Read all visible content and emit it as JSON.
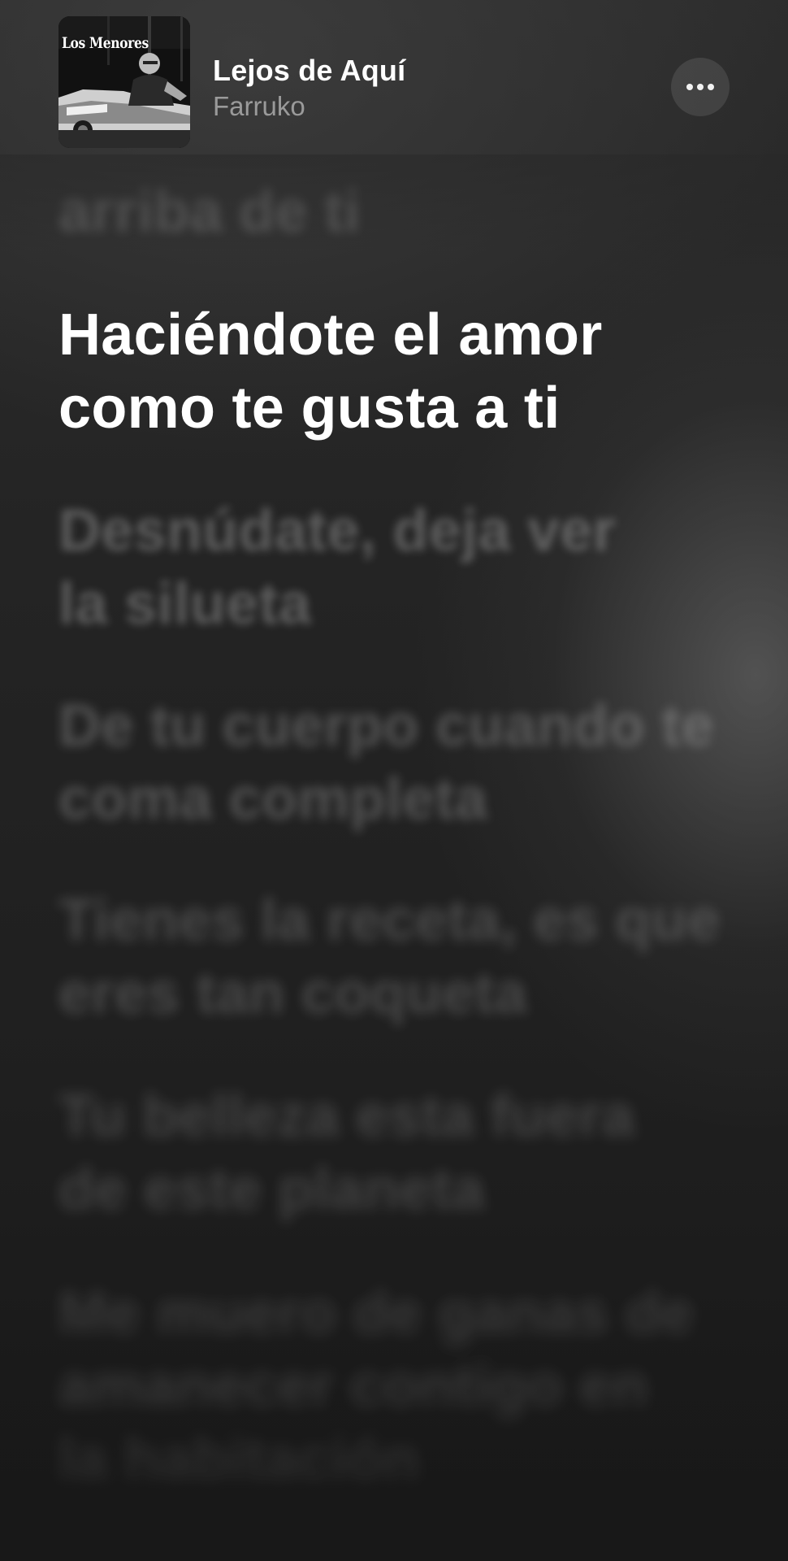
{
  "now_playing": {
    "artwork_text": "Los Menores",
    "title": "Lejos de Aquí",
    "artist": "Farruko",
    "more_icon": "ellipsis-icon"
  },
  "lyrics": {
    "previous": "arriba de ti",
    "current": "Haciéndote el amor\ncomo te gusta a ti",
    "upcoming": [
      "Desnúdate, deja ver\nla silueta",
      "De tu cuerpo cuando te\ncoma completa",
      "Tienes la receta, es que\neres tan coqueta",
      "Tu belleza esta fuera\nde este planeta",
      "Me muero de ganas de\namanecer contigo en\nla habitación"
    ]
  },
  "colors": {
    "background": "#1f1f1f",
    "active_lyric": "#ffffff",
    "artist_text": "#9a9a9a"
  }
}
